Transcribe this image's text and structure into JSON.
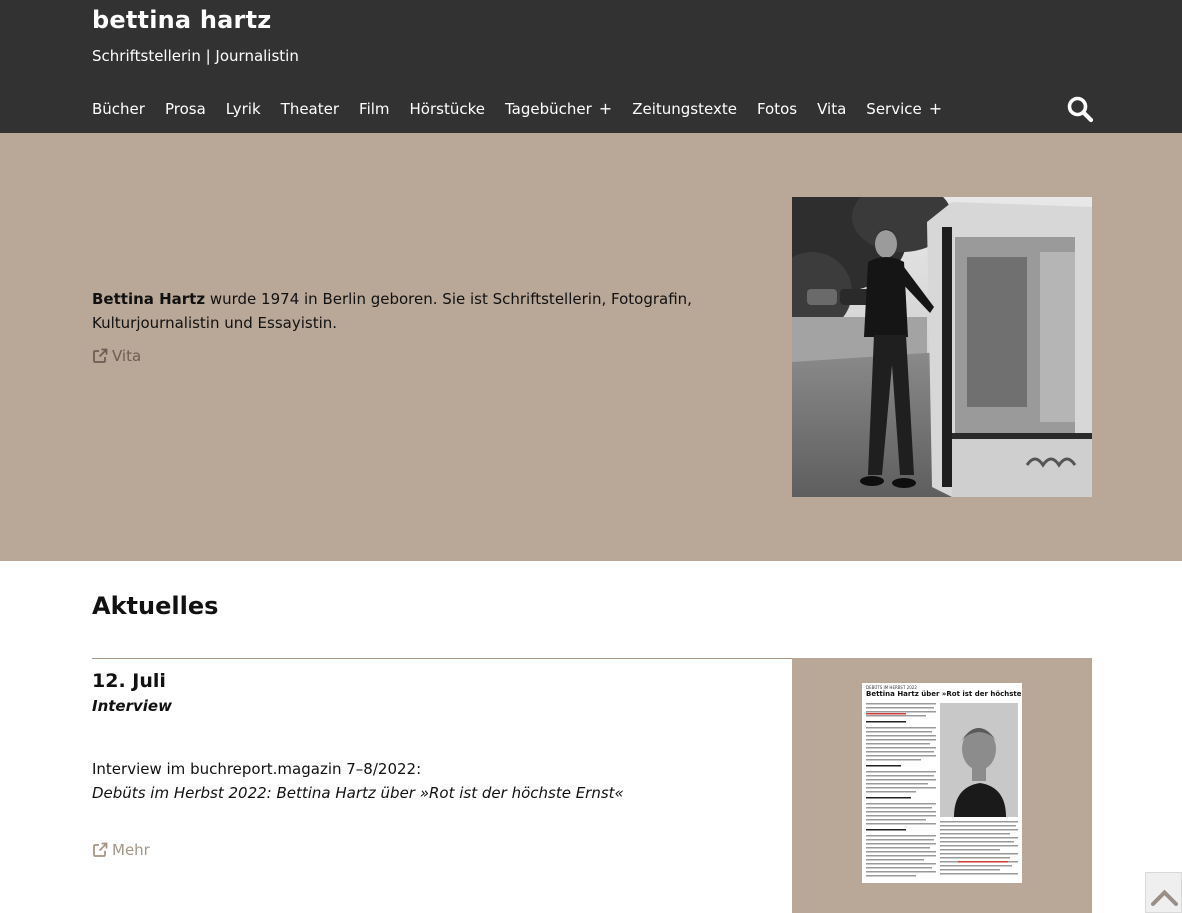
{
  "site": {
    "title": "bettina hartz",
    "tagline": "Schriftstellerin | Journalistin"
  },
  "nav": {
    "items": [
      {
        "label": "Bücher",
        "has_submenu": false
      },
      {
        "label": "Prosa",
        "has_submenu": false
      },
      {
        "label": "Lyrik",
        "has_submenu": false
      },
      {
        "label": "Theater",
        "has_submenu": false
      },
      {
        "label": "Film",
        "has_submenu": false
      },
      {
        "label": "Hörstücke",
        "has_submenu": false
      },
      {
        "label": "Tagebücher",
        "has_submenu": true
      },
      {
        "label": "Zeitungstexte",
        "has_submenu": false
      },
      {
        "label": "Fotos",
        "has_submenu": false
      },
      {
        "label": "Vita",
        "has_submenu": false
      },
      {
        "label": "Service",
        "has_submenu": true
      }
    ],
    "submenu_symbol": "+",
    "search_icon": "search-icon"
  },
  "hero": {
    "name": "Bettina Hartz",
    "intro": " wurde 1974 in Berlin geboren. Sie ist Schriftstellerin, Fotografin, Kulturjournalistin und Essayistin.",
    "link_label": "Vita",
    "link_icon": "external-link-icon"
  },
  "news": {
    "section_title": "Aktuelles",
    "items": [
      {
        "date": "12. Juli",
        "type": "Interview",
        "line1": "Interview im buchreport.magazin 7–8/2022:",
        "line2": "Debüts im Herbst 2022: Bettina Hartz über »Rot ist der höchste Ernst«",
        "link_label": "Mehr",
        "thumb_kicker": "DEBÜTS IM HERBST 2022",
        "thumb_title": "Bettina Hartz über »Rot ist der höchste Ernst«"
      }
    ]
  },
  "scroll_top_icon": "chevron-up-icon",
  "colors": {
    "header_bg": "#323232",
    "accent_bg": "#b9a797",
    "link_dark": "#6b5e52",
    "link_light": "#a49586"
  }
}
